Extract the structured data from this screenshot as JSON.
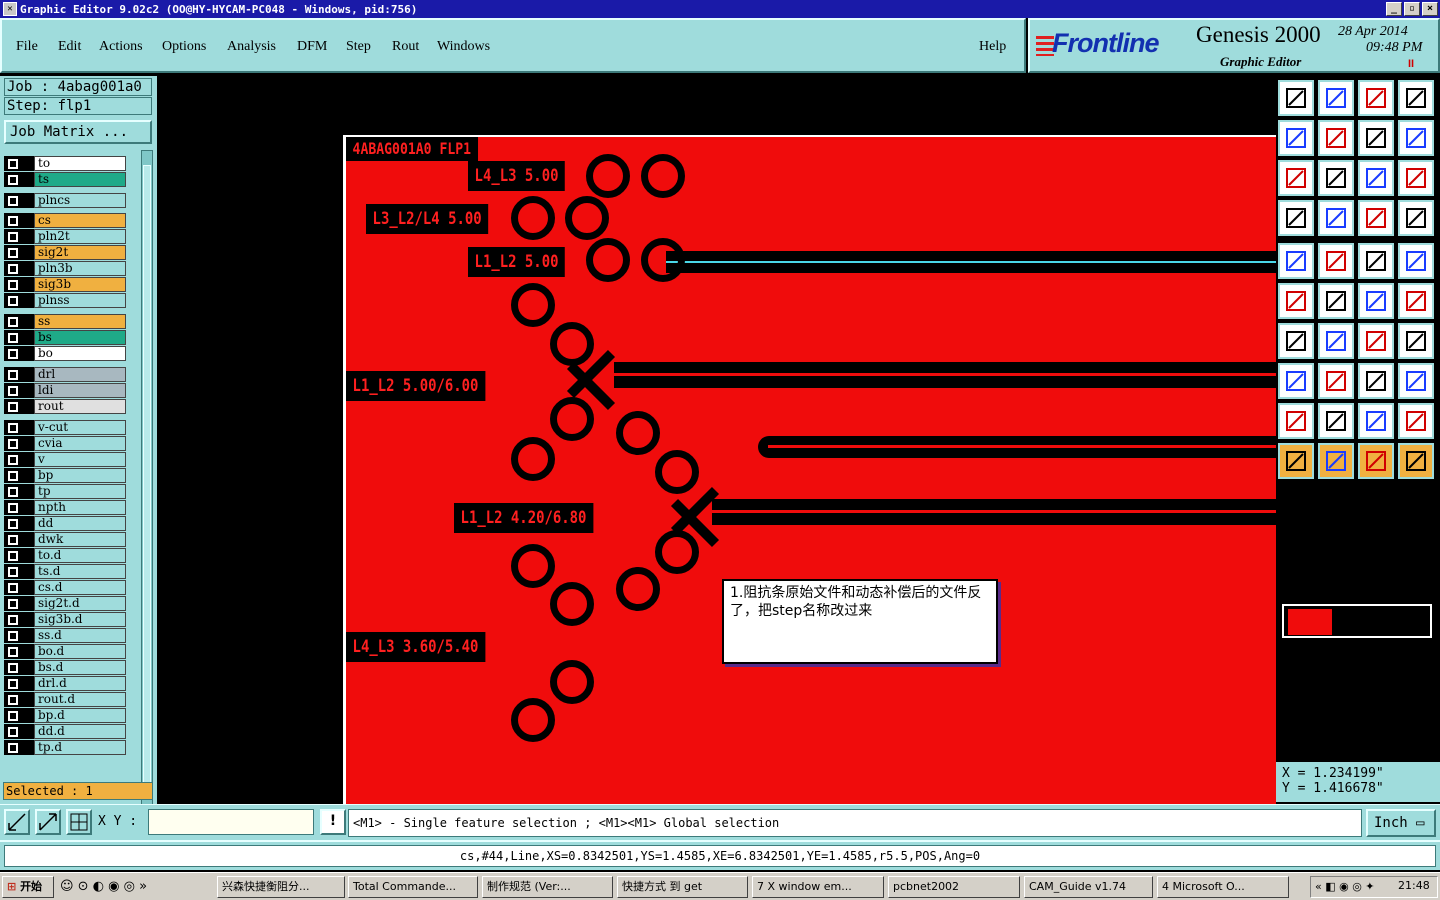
{
  "window": {
    "title": "Graphic Editor 9.02c2  (OO@HY-HYCAM-PC048 - Windows, pid:756)"
  },
  "menu": {
    "items": [
      "File",
      "Edit",
      "Actions",
      "Options",
      "Analysis",
      "DFM",
      "Step",
      "Rout",
      "Windows"
    ],
    "help": "Help"
  },
  "brand": {
    "logo": "Frontline",
    "product": "Genesis 2000",
    "subtitle": "Graphic Editor",
    "date": "28 Apr 2014",
    "time": "09:48 PM",
    "pause": "II"
  },
  "job": {
    "job": "Job : 4abag001a0",
    "step": "Step: flp1",
    "matrix": "Job Matrix ..."
  },
  "layers": [
    {
      "name": "to",
      "color": "#ffffff"
    },
    {
      "name": "ts",
      "color": "#1faa88"
    },
    {
      "name": "plncs",
      "color": "#9fdcdc"
    },
    {
      "name": "cs",
      "color": "#f0b040"
    },
    {
      "name": "pln2t",
      "color": "#9fdcdc"
    },
    {
      "name": "sig2t",
      "color": "#f0b040"
    },
    {
      "name": "pln3b",
      "color": "#9fdcdc"
    },
    {
      "name": "sig3b",
      "color": "#f0b040"
    },
    {
      "name": "plnss",
      "color": "#9fdcdc"
    },
    {
      "name": "ss",
      "color": "#f0b040"
    },
    {
      "name": "bs",
      "color": "#1faa88"
    },
    {
      "name": "bo",
      "color": "#ffffff"
    },
    {
      "name": "drl",
      "color": "#a8b8c0"
    },
    {
      "name": "ldi",
      "color": "#a8b8c0"
    },
    {
      "name": "rout",
      "color": "#e0e0e0"
    },
    {
      "name": "v-cut",
      "color": "#9fdcdc"
    },
    {
      "name": "cvia",
      "color": "#9fdcdc"
    },
    {
      "name": "v",
      "color": "#9fdcdc"
    },
    {
      "name": "bp",
      "color": "#9fdcdc"
    },
    {
      "name": "tp",
      "color": "#9fdcdc"
    },
    {
      "name": "npth",
      "color": "#9fdcdc"
    },
    {
      "name": "dd",
      "color": "#9fdcdc"
    },
    {
      "name": "dwk",
      "color": "#9fdcdc"
    },
    {
      "name": "to.d",
      "color": "#9fdcdc"
    },
    {
      "name": "ts.d",
      "color": "#9fdcdc"
    },
    {
      "name": "cs.d",
      "color": "#9fdcdc"
    },
    {
      "name": "sig2t.d",
      "color": "#9fdcdc"
    },
    {
      "name": "sig3b.d",
      "color": "#9fdcdc"
    },
    {
      "name": "ss.d",
      "color": "#9fdcdc"
    },
    {
      "name": "bo.d",
      "color": "#9fdcdc"
    },
    {
      "name": "bs.d",
      "color": "#9fdcdc"
    },
    {
      "name": "drl.d",
      "color": "#9fdcdc"
    },
    {
      "name": "rout.d",
      "color": "#9fdcdc"
    },
    {
      "name": "bp.d",
      "color": "#9fdcdc"
    },
    {
      "name": "dd.d",
      "color": "#9fdcdc"
    },
    {
      "name": "tp.d",
      "color": "#9fdcdc"
    }
  ],
  "selected": "Selected : 1",
  "canvas": {
    "board_title": "4ABAG001A0 FLP1",
    "labels": [
      "L4_L3 5.00",
      "L3_L2/L4 5.00",
      "L1_L2 5.00",
      "L1_L2 5.00/6.00",
      "L1_L2 4.20/6.80",
      "L4_L3 3.60/5.40"
    ],
    "note": "1.阻抗条原始文件和动态补偿后的文件反了，把step名称改过来"
  },
  "coords": {
    "x": "X = 1.234199\"",
    "y": "Y = 1.416678\""
  },
  "bottom": {
    "xy_label": "X Y :",
    "xy_value": "",
    "message": "<M1> - Single feature selection ; <M1><M1> Global selection",
    "unit": "Inch",
    "warn": "!"
  },
  "status": "cs,#44,Line,XS=0.8342501,YS=1.4585,XE=6.8342501,YE=1.4585,r5.5,POS,Ang=0",
  "taskbar": {
    "start": "开始",
    "tasks": [
      "兴森快捷衡阻分...",
      "Total Commande...",
      "制作规范 (Ver:...",
      "快捷方式 到 get",
      "7 X window em...",
      "pcbnet2002",
      "CAM_Guide v1.74",
      "4 Microsoft O..."
    ],
    "clock": "21:48"
  },
  "colors": {
    "board": "#f00c0c",
    "panel": "#9fdcdc",
    "title": "#1a1aa8"
  }
}
